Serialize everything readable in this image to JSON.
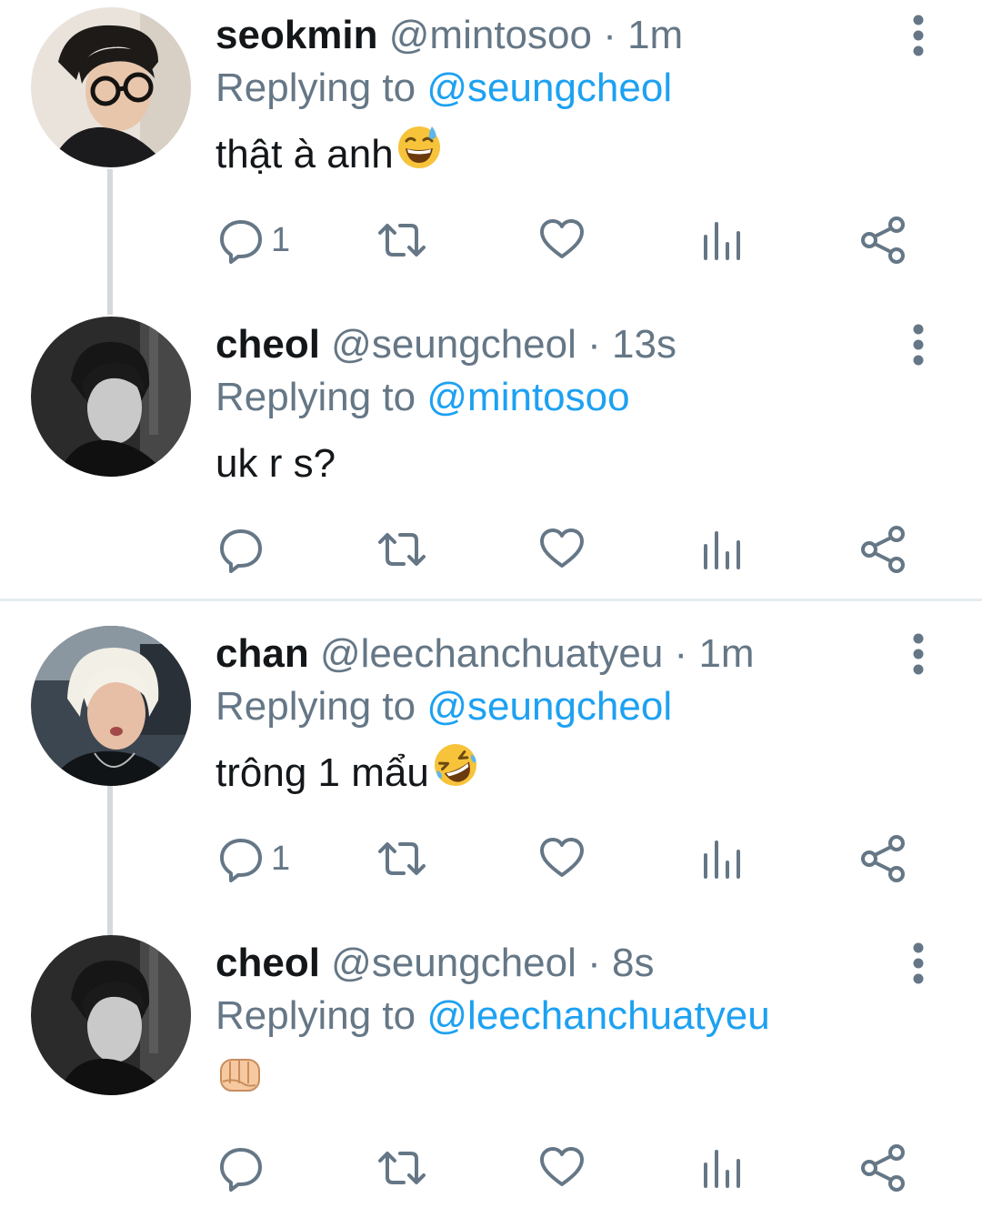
{
  "tweets": [
    {
      "name": "seokmin",
      "handle": "@mintosoo",
      "separator": "·",
      "time": "1m",
      "replying_prefix": "Replying to",
      "replying_to": "@seungcheol",
      "text": "thật à anh",
      "emoji": "grinning-sweat-emoji",
      "reply_count": "1",
      "avatar": "person-with-glasses-avatar"
    },
    {
      "name": "cheol",
      "handle": "@seungcheol",
      "separator": "·",
      "time": "13s",
      "replying_prefix": "Replying to",
      "replying_to": "@mintosoo",
      "text": "uk r s?",
      "emoji": "",
      "reply_count": "",
      "avatar": "monochrome-portrait-avatar"
    },
    {
      "name": "chan",
      "handle": "@leechanchuatyeu",
      "separator": "·",
      "time": "1m",
      "replying_prefix": "Replying to",
      "replying_to": "@seungcheol",
      "text": "trông 1 mẩu",
      "emoji": "rolling-laughing-emoji",
      "reply_count": "1",
      "avatar": "blond-hair-avatar"
    },
    {
      "name": "cheol",
      "handle": "@seungcheol",
      "separator": "·",
      "time": "8s",
      "replying_prefix": "Replying to",
      "replying_to": "@leechanchuatyeu",
      "text": "",
      "emoji": "oncoming-fist-emoji",
      "reply_count": "",
      "avatar": "monochrome-portrait-avatar"
    }
  ],
  "icons": {
    "reply": "reply-icon",
    "retweet": "retweet-icon",
    "like": "heart-icon",
    "analytics": "analytics-icon",
    "share": "share-icon",
    "more": "more-vertical-icon"
  },
  "colors": {
    "name": "#14171a",
    "secondary": "#657786",
    "mention": "#1da1f2",
    "thread_line": "#d4d9dd",
    "divider": "#e6ecf0"
  }
}
